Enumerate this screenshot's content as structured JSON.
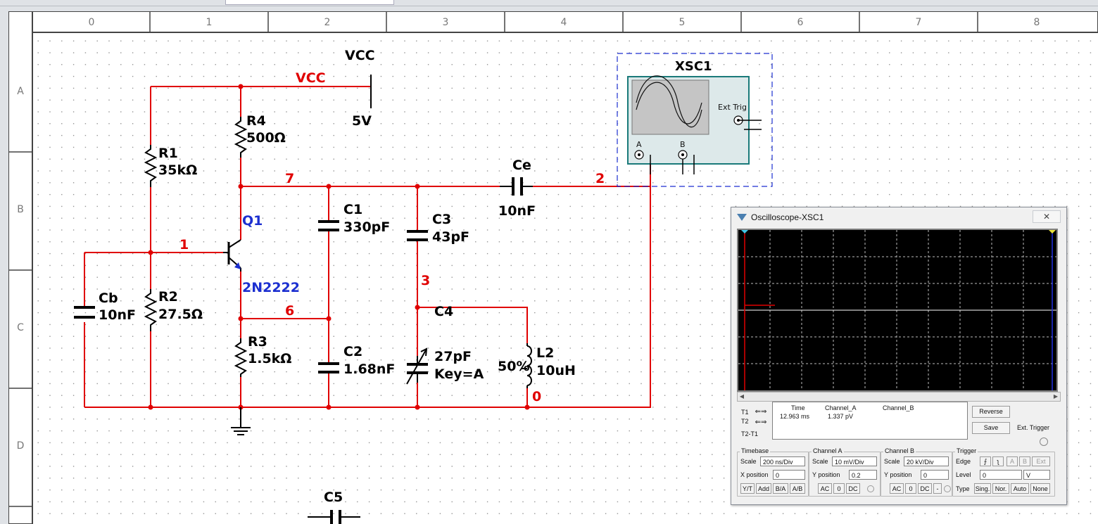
{
  "grid": {
    "columns": [
      "0",
      "1",
      "2",
      "3",
      "4",
      "5",
      "6",
      "7",
      "8"
    ],
    "rows": [
      "A",
      "B",
      "C",
      "D"
    ]
  },
  "schematic": {
    "vcc_label": "VCC",
    "vcc_net_label": "VCC",
    "vcc_value": "5V",
    "nets": {
      "n1": "1",
      "n7": "7",
      "n6": "6",
      "n3": "3",
      "n2": "2",
      "n0": "0"
    },
    "r1": {
      "name": "R1",
      "value": "35kΩ"
    },
    "r2": {
      "name": "R2",
      "value": "27.5Ω"
    },
    "r3": {
      "name": "R3",
      "value": "1.5kΩ"
    },
    "r4": {
      "name": "R4",
      "value": "500Ω"
    },
    "cb": {
      "name": "Cb",
      "value": "10nF"
    },
    "c1": {
      "name": "C1",
      "value": "330pF"
    },
    "c2": {
      "name": "C2",
      "value": "1.68nF"
    },
    "c3": {
      "name": "C3",
      "value": "43pF"
    },
    "c4": {
      "name": "C4",
      "value": "27pF",
      "key": "Key=A"
    },
    "ce": {
      "name": "Ce",
      "value": "10nF"
    },
    "c5": {
      "name": "C5"
    },
    "l2": {
      "name": "L2",
      "value": "10uH",
      "percent": "50%"
    },
    "q1": {
      "name": "Q1",
      "model": "2N2222"
    },
    "xsc1": {
      "name": "XSC1",
      "ext_trig": "Ext Trig",
      "ch_a": "A",
      "ch_b": "B"
    }
  },
  "colors": {
    "wire": "#e00000",
    "net_label": "#e00000",
    "transistor": "#1c2fd0",
    "text": "#000000"
  },
  "oscilloscope": {
    "title": "Oscilloscope-XSC1",
    "close": "✕",
    "readout": {
      "headers": {
        "time": "Time",
        "cha": "Channel_A",
        "chb": "Channel_B"
      },
      "t1": "T1",
      "t2": "T2",
      "t2t1": "T2-T1",
      "time_value": "12.963 ms",
      "cha_value": "1.337 pV"
    },
    "buttons": {
      "reverse": "Reverse",
      "save": "Save",
      "ext_trigger": "Ext. Trigger"
    },
    "timebase": {
      "title": "Timebase",
      "scale_label": "Scale",
      "scale": "200 ns/Div",
      "xpos_label": "X position",
      "xpos": "0",
      "yt": "Y/T",
      "add": "Add",
      "ba": "B/A",
      "ab": "A/B"
    },
    "channel_a": {
      "title": "Channel A",
      "scale_label": "Scale",
      "scale": "10 mV/Div",
      "ypos_label": "Y position",
      "ypos": "0.2",
      "ac": "AC",
      "zero": "0",
      "dc": "DC"
    },
    "channel_b": {
      "title": "Channel B",
      "scale_label": "Scale",
      "scale": "20 kV/Div",
      "ypos_label": "Y position",
      "ypos": "0",
      "ac": "AC",
      "zero": "0",
      "dc": "DC",
      "minus": "-"
    },
    "trigger": {
      "title": "Trigger",
      "edge_label": "Edge",
      "a": "A",
      "b": "B",
      "ext": "Ext",
      "level_label": "Level",
      "level": "0",
      "unit": "V",
      "type_label": "Type",
      "sing": "Sing.",
      "nor": "Nor.",
      "auto": "Auto",
      "none": "None"
    }
  }
}
